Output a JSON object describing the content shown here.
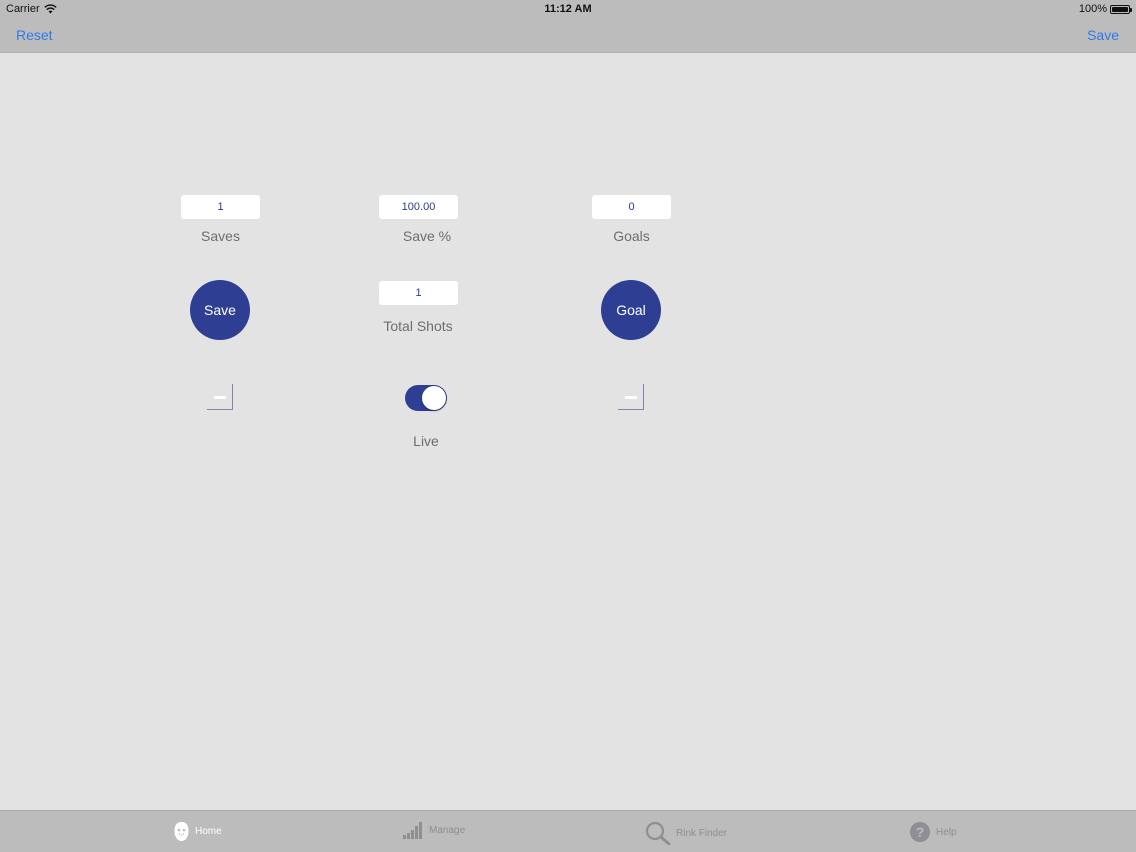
{
  "status_bar": {
    "carrier": "Carrier",
    "time": "11:12 AM",
    "battery": "100%"
  },
  "nav": {
    "left_label": "Reset",
    "right_label": "Save"
  },
  "stats": {
    "saves_value": "1",
    "saves_label": "Saves",
    "save_pct_value": "100.00",
    "save_pct_label": "Save %",
    "goals_value": "0",
    "goals_label": "Goals",
    "total_shots_value": "1",
    "total_shots_label": "Total Shots"
  },
  "controls": {
    "save_button": "Save",
    "goal_button": "Goal",
    "live_label": "Live",
    "live_on": true
  },
  "tabs": [
    {
      "label": "Home",
      "icon": "goalie-mask-icon",
      "active": true
    },
    {
      "label": "Manage",
      "icon": "bar-signal-icon",
      "active": false
    },
    {
      "label": "Rink Finder",
      "icon": "magnifier-icon",
      "active": false
    },
    {
      "label": "Help",
      "icon": "question-circle-icon",
      "active": false
    }
  ],
  "colors": {
    "accent": "#2e3f93",
    "nav_link": "#2f7ae5",
    "background": "#e3e3e4",
    "bars": "#bcbcbd"
  }
}
